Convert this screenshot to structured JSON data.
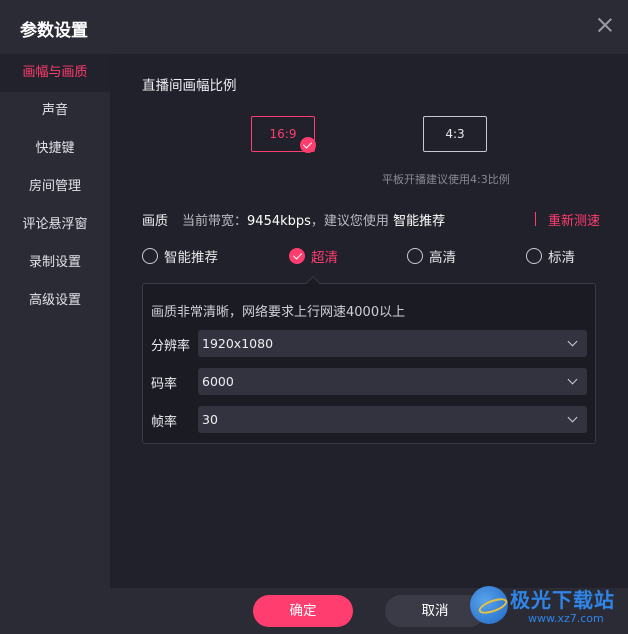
{
  "window": {
    "title": "参数设置"
  },
  "sidebar": {
    "items": [
      {
        "label": "画幅与画质",
        "active": true
      },
      {
        "label": "声音"
      },
      {
        "label": "快捷键"
      },
      {
        "label": "房间管理"
      },
      {
        "label": "评论悬浮窗"
      },
      {
        "label": "录制设置"
      },
      {
        "label": "高级设置"
      }
    ]
  },
  "aspect": {
    "title": "直播间画幅比例",
    "options": [
      {
        "label": "16:9",
        "selected": true
      },
      {
        "label": "4:3"
      }
    ],
    "hint": "平板开播建议使用4:3比例"
  },
  "quality": {
    "label": "画质",
    "bandwidth_text": "当前带宽：",
    "bandwidth_value": "9454kbps",
    "suggest_text": "，建议您使用",
    "suggest_value": "智能推荐",
    "retest": "重新测速",
    "options": [
      {
        "label": "智能推荐"
      },
      {
        "label": "超清",
        "checked": true
      },
      {
        "label": "高清"
      },
      {
        "label": "标清"
      }
    ]
  },
  "panel": {
    "description": "画质非常清晰，网络要求上行网速4000以上",
    "fields": [
      {
        "label": "分辨率",
        "value": "1920x1080"
      },
      {
        "label": "码率",
        "value": "6000"
      },
      {
        "label": "帧率",
        "value": "30"
      }
    ]
  },
  "footer": {
    "ok": "确定",
    "cancel": "取消"
  },
  "watermark": {
    "text": "极光下载站",
    "url": "www.xz7.com"
  },
  "colors": {
    "accent": "#ff3d6e",
    "background": "#21212b",
    "sidebar": "#2b2b36"
  }
}
